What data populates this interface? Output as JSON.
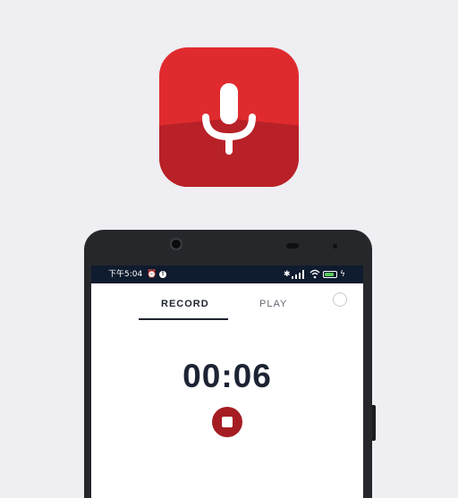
{
  "app_icon": {
    "icon": "microphone-icon",
    "colors": {
      "top": "#e02b2e",
      "bottom": "#b82127"
    }
  },
  "statusbar": {
    "time": "下午5:04",
    "icons": [
      "alarm-icon",
      "notification-icon",
      "bluetooth-icon",
      "signal-icon",
      "wifi-icon",
      "battery-icon",
      "charging-icon"
    ],
    "battery_level": 0.8
  },
  "tabs": [
    {
      "label": "RECORD",
      "active": true
    },
    {
      "label": "PLAY",
      "active": false
    }
  ],
  "timer": "00:06",
  "controls": {
    "stop_icon": "stop-icon",
    "accent": "#a51d22"
  }
}
